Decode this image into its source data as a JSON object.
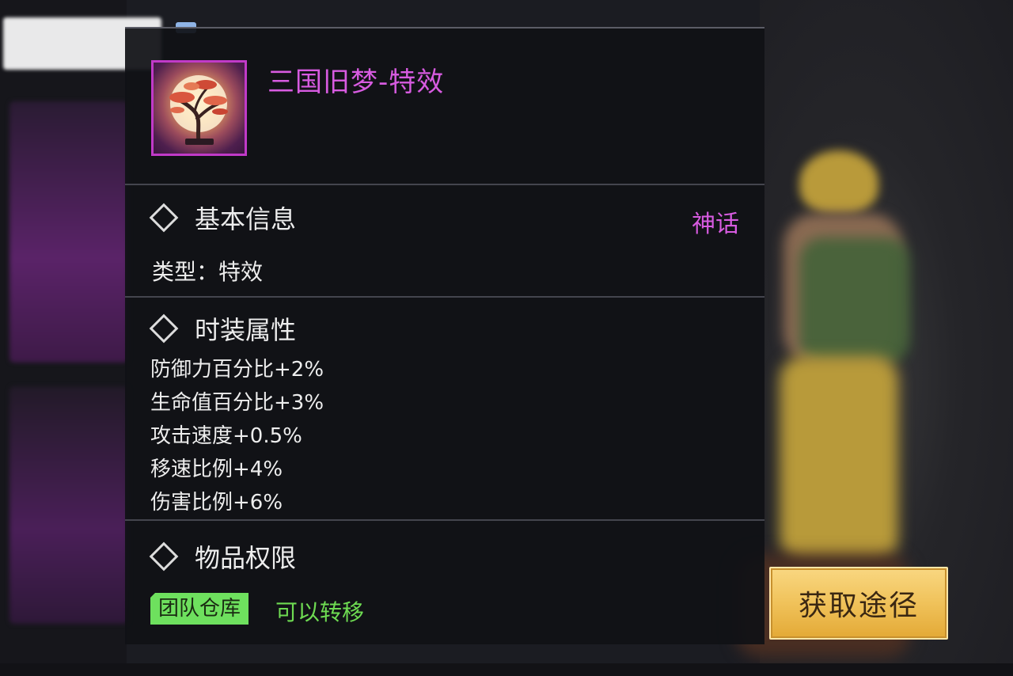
{
  "item": {
    "name": "三国旧梦-特效",
    "icon": "bonsai-moon-icon",
    "rarity": "神话",
    "rarity_color": "#d75be0"
  },
  "basic_info": {
    "title": "基本信息",
    "type_label": "类型：",
    "type_value": "特效"
  },
  "fashion_attrs": {
    "title": "时装属性",
    "items": [
      "防御力百分比+2%",
      "生命值百分比+3%",
      "攻击速度+0.5%",
      "移速比例+4%",
      "伤害比例+6%"
    ]
  },
  "permissions": {
    "title": "物品权限",
    "badge": "团队仓库",
    "transfer": "可以转移",
    "badge_color": "#6ee05e"
  },
  "actions": {
    "acquire_label": "获取途径"
  }
}
